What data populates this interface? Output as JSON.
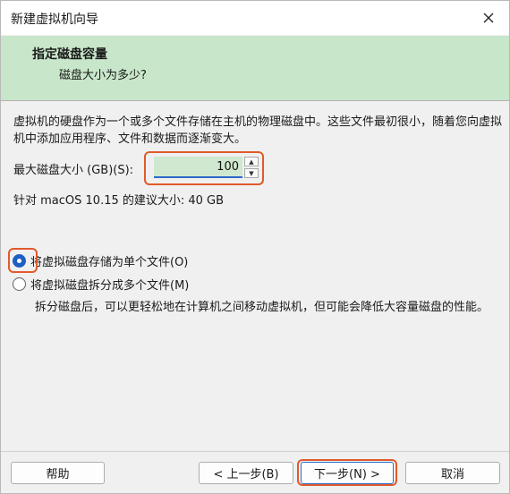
{
  "window": {
    "title": "新建虚拟机向导"
  },
  "header": {
    "title": "指定磁盘容量",
    "subtitle": "磁盘大小为多少?"
  },
  "description": "虚拟机的硬盘作为一个或多个文件存储在主机的物理磁盘中。这些文件最初很小，随着您向虚拟机中添加应用程序、文件和数据而逐渐变大。",
  "disk_size": {
    "label": "最大磁盘大小 (GB)(S):",
    "value": "100"
  },
  "recommendation": "针对 macOS 10.15 的建议大小: 40 GB",
  "options": {
    "single_file": {
      "label": "将虚拟磁盘存储为单个文件(O)",
      "checked": true
    },
    "split_files": {
      "label": "将虚拟磁盘拆分成多个文件(M)",
      "checked": false,
      "description": "拆分磁盘后，可以更轻松地在计算机之间移动虚拟机，但可能会降低大容量磁盘的性能。"
    }
  },
  "buttons": {
    "help": "帮助",
    "back": "< 上一步(B)",
    "next": "下一步(N) >",
    "cancel": "取消"
  },
  "colors": {
    "header_band": "#c8e6c9",
    "accent": "#1f5fc4",
    "highlight": "#e05a2b",
    "input_bg": "#cfe8cf"
  }
}
